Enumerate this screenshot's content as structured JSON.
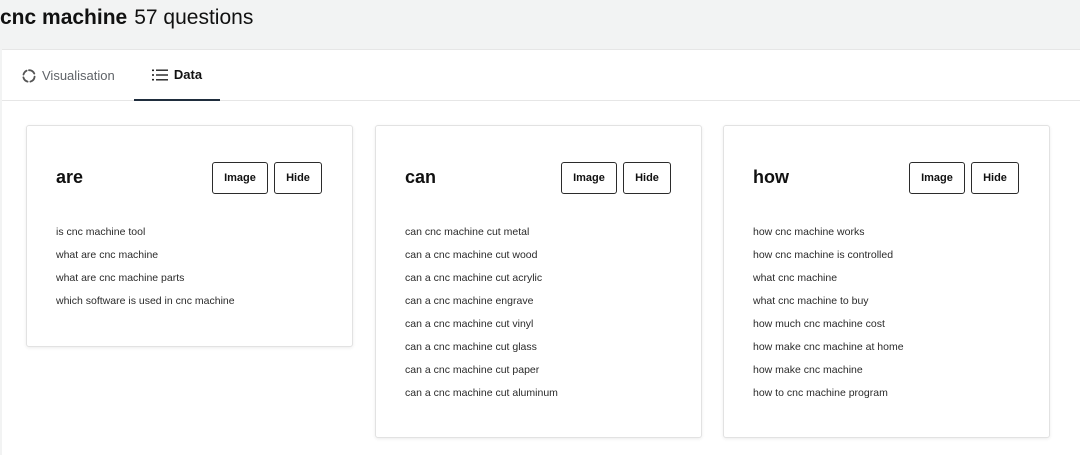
{
  "header": {
    "keyword": "cnc machine",
    "count_label": "57 questions"
  },
  "tabs": [
    {
      "label": "Visualisation",
      "icon": "circle-dashed-icon",
      "active": false
    },
    {
      "label": "Data",
      "icon": "list-icon",
      "active": true
    }
  ],
  "cards": [
    {
      "title": "are",
      "image_label": "Image",
      "hide_label": "Hide",
      "items": [
        "is cnc machine tool",
        "what are cnc machine",
        "what are cnc machine parts",
        "which software is used in cnc machine"
      ]
    },
    {
      "title": "can",
      "image_label": "Image",
      "hide_label": "Hide",
      "items": [
        "can cnc machine cut metal",
        "can a cnc machine cut wood",
        "can a cnc machine cut acrylic",
        "can a cnc machine engrave",
        "can a cnc machine cut vinyl",
        "can a cnc machine cut glass",
        "can a cnc machine cut paper",
        "can a cnc machine cut aluminum"
      ]
    },
    {
      "title": "how",
      "image_label": "Image",
      "hide_label": "Hide",
      "items": [
        "how cnc machine works",
        "how cnc machine is controlled",
        "what cnc machine",
        "what cnc machine to buy",
        "how much cnc machine cost",
        "how make cnc machine at home",
        "how make cnc machine",
        "how to cnc machine program"
      ]
    }
  ],
  "colors": {
    "background": "#f2f3f3",
    "panel": "#ffffff",
    "active_tab_underline": "#1f2d3d",
    "inactive_tab_text": "#5f6368"
  }
}
